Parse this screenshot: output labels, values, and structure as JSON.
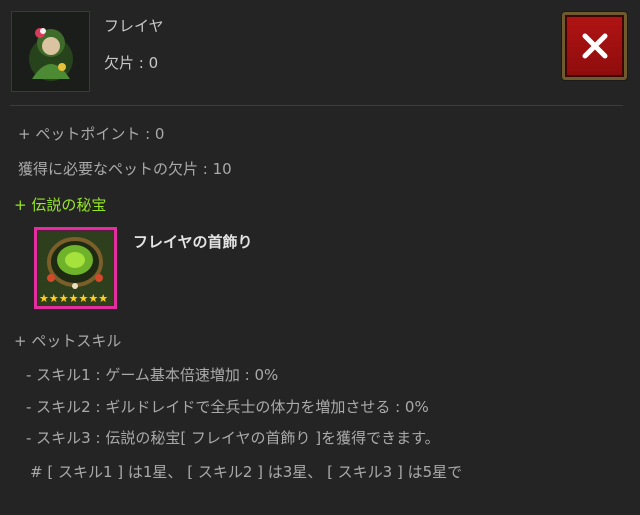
{
  "header": {
    "pet_name": "フレイヤ",
    "shard_label": "欠片 : 0"
  },
  "close_button": {
    "icon": "close-icon"
  },
  "stats": {
    "pet_points": "+ ペットポイント : 0",
    "required_shards": "獲得に必要なペットの欠片 : 10"
  },
  "legendary_treasure": {
    "heading": "+ 伝説の秘宝",
    "item_name": "フレイヤの首飾り",
    "star_count": 7,
    "frame_color": "#e42d9e"
  },
  "pet_skills": {
    "heading": "+ ペットスキル",
    "skills": [
      "- スキル1 : ゲーム基本倍速増加 : 0%",
      "- スキル2 : ギルドレイドで全兵士の体力を増加させる : 0%",
      "- スキル3 : 伝説の秘宝[ フレイヤの首飾り ]を獲得できます。"
    ],
    "note": "# [ スキル1 ] は1星、 [ スキル2 ] は3星、 [ スキル3 ] は5星で"
  },
  "colors": {
    "accent_green": "#96e626",
    "close_red": "#b11414",
    "background": "#242424"
  }
}
